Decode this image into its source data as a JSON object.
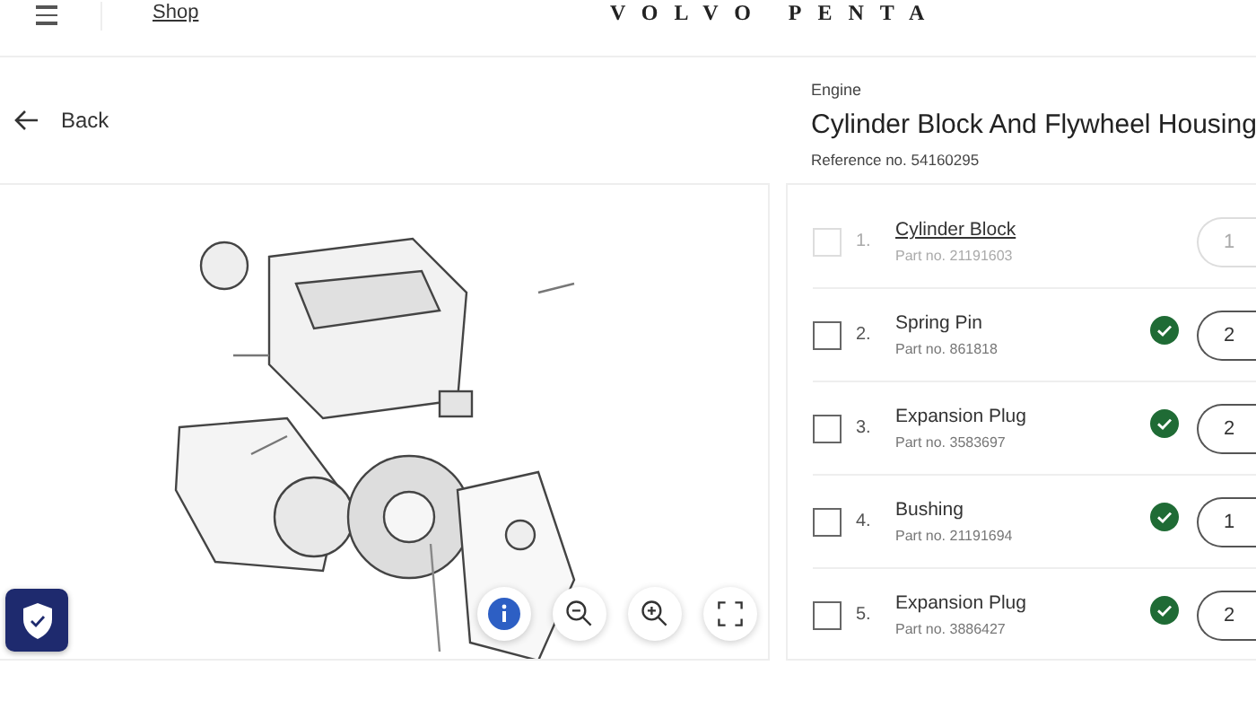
{
  "header": {
    "shop_link": "Shop",
    "logo": "VOLVO PENTA"
  },
  "back": {
    "label": "Back"
  },
  "heading": {
    "category": "Engine",
    "title": "Cylinder Block And Flywheel Housing",
    "reference": "Reference no. 54160295"
  },
  "diagram": {
    "kind": "picture",
    "controls": [
      {
        "kind": "info"
      },
      {
        "kind": "zoom-out"
      },
      {
        "kind": "zoom-in"
      },
      {
        "kind": "fullscreen"
      }
    ]
  },
  "parts": [
    {
      "index": "1.",
      "name": "Cylinder Block",
      "part_no": "Part no. 21191603",
      "quantity": "1",
      "disabled": true,
      "checked": false,
      "available": false
    },
    {
      "index": "2.",
      "name": "Spring Pin",
      "part_no": "Part no. 861818",
      "quantity": "2",
      "disabled": false,
      "checked": false,
      "available": true
    },
    {
      "index": "3.",
      "name": "Expansion Plug",
      "part_no": "Part no. 3583697",
      "quantity": "2",
      "disabled": false,
      "checked": false,
      "available": true
    },
    {
      "index": "4.",
      "name": "Bushing",
      "part_no": "Part no. 21191694",
      "quantity": "1",
      "disabled": false,
      "checked": false,
      "available": true
    },
    {
      "index": "5.",
      "name": "Expansion Plug",
      "part_no": "Part no. 3886427",
      "quantity": "2",
      "disabled": false,
      "checked": false,
      "available": true
    }
  ]
}
